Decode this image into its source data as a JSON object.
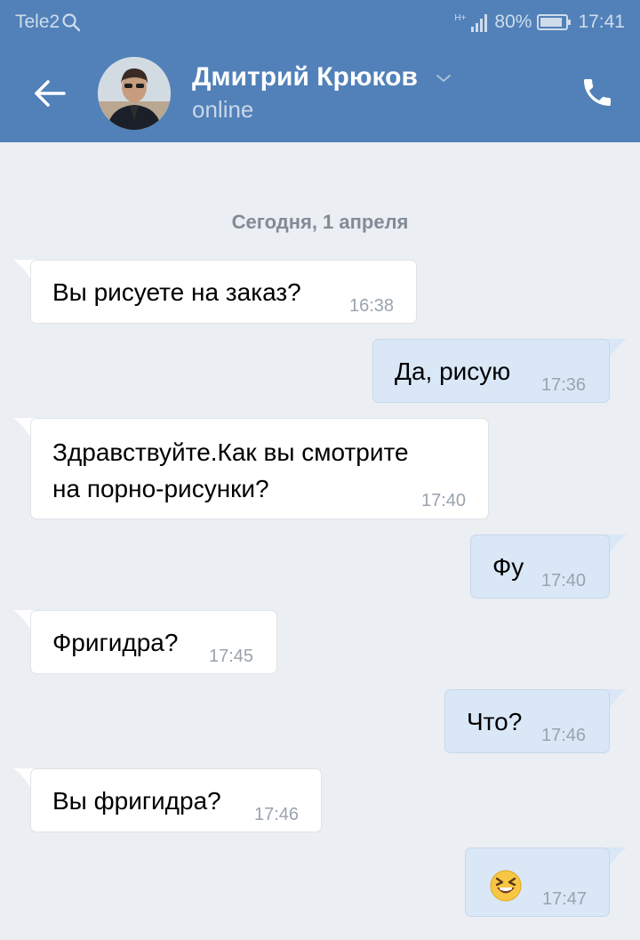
{
  "status_bar": {
    "carrier": "Tele2",
    "network": "H+",
    "battery": "80%",
    "time": "17:41"
  },
  "header": {
    "contact_name": "Дмитрий Крюков",
    "status": "online"
  },
  "chat": {
    "date_separator": "Сегодня, 1 апреля",
    "messages": [
      {
        "direction": "in",
        "text": "Вы рисуете на заказ?",
        "time": "16:38"
      },
      {
        "direction": "out",
        "text": "Да, рисую",
        "time": "17:36"
      },
      {
        "direction": "in",
        "text_line1": "Здравствуйте.Как вы смотрите",
        "text_line2": "на порно-рисунки?",
        "time": "17:40"
      },
      {
        "direction": "out",
        "text": "Фу",
        "time": "17:40"
      },
      {
        "direction": "in",
        "text": "Фригидра?",
        "time": "17:45"
      },
      {
        "direction": "out",
        "text": "Что?",
        "time": "17:46"
      },
      {
        "direction": "in",
        "text": "Вы фригидра?",
        "time": "17:46"
      },
      {
        "direction": "out",
        "emoji": "laughing-squint-emoji",
        "time": "17:47"
      }
    ]
  },
  "colors": {
    "header": "#5181b8",
    "background": "#ebeef3",
    "incoming_bubble": "#ffffff",
    "outgoing_bubble": "#d9e7f7"
  }
}
